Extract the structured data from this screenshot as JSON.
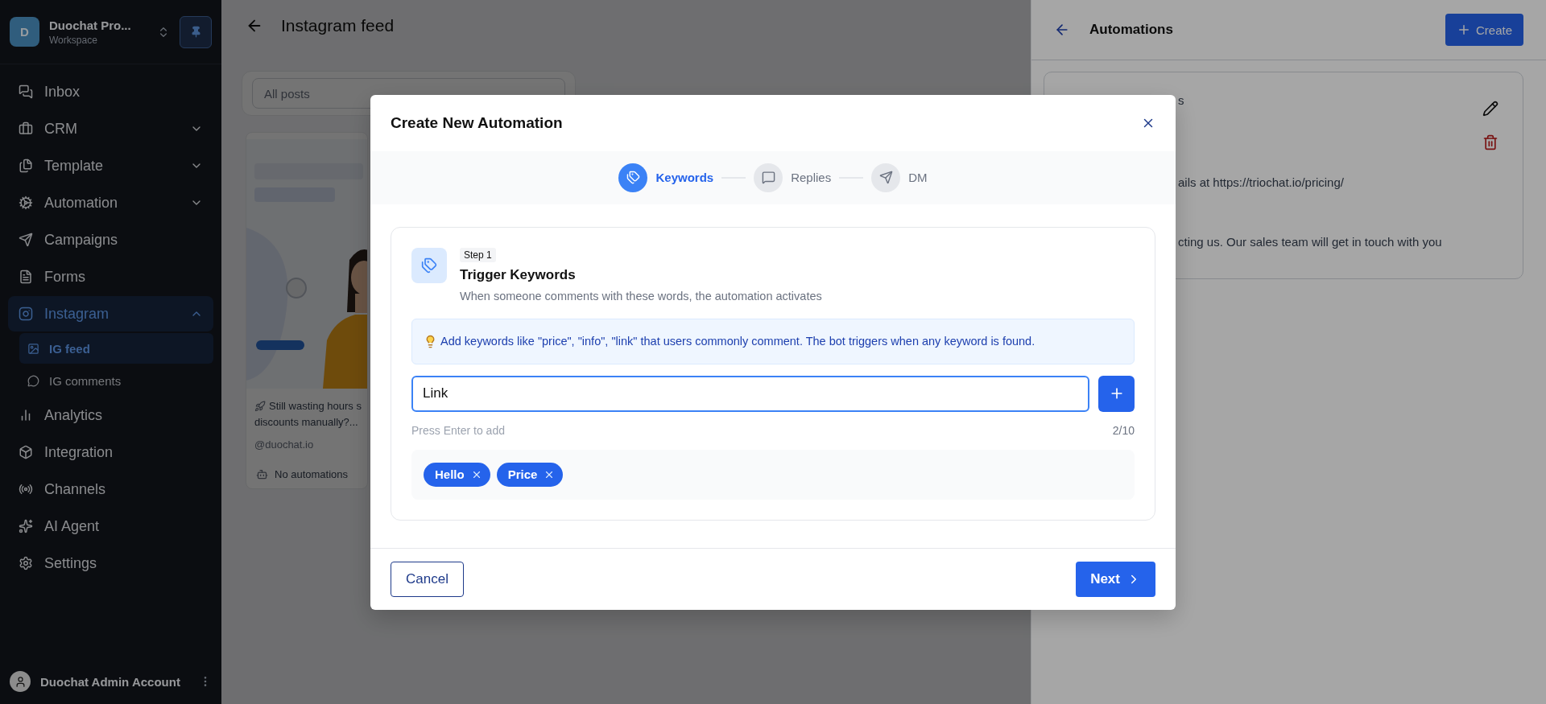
{
  "sidebar": {
    "workspace": {
      "avatar": "D",
      "name": "Duochat Pro...",
      "subtitle": "Workspace"
    },
    "items": [
      {
        "label": "Inbox",
        "selected": false
      },
      {
        "label": "CRM",
        "selected": false,
        "expanded": false
      },
      {
        "label": "Template",
        "selected": false,
        "expanded": false
      },
      {
        "label": "Automation",
        "selected": false,
        "expanded": false
      },
      {
        "label": "Campaigns",
        "selected": false
      },
      {
        "label": "Forms",
        "selected": false
      },
      {
        "label": "Instagram",
        "selected": true,
        "expanded": true,
        "children": [
          {
            "label": "IG feed",
            "selected": true
          },
          {
            "label": "IG comments",
            "selected": false
          }
        ]
      },
      {
        "label": "Analytics",
        "selected": false
      },
      {
        "label": "Integration",
        "selected": false
      },
      {
        "label": "Channels",
        "selected": false
      },
      {
        "label": "AI Agent",
        "selected": false
      },
      {
        "label": "Settings",
        "selected": false
      }
    ],
    "account": {
      "name": "Duochat Admin Account"
    }
  },
  "main": {
    "title": "Instagram feed",
    "filter": {
      "value": "All posts"
    },
    "posts": [
      {
        "kind": "picture",
        "caption_lines": [
          "Still wasting hours s",
          "discounts manually?..."
        ],
        "handle": "@duochat.io",
        "status": "No automations"
      }
    ]
  },
  "drawer": {
    "title": "Automations",
    "create_button": "Create",
    "card": {
      "lines": [
        "s",
        "ails at https://triochat.io/pricing/",
        "cting us. Our sales team will get in touch with you"
      ]
    }
  },
  "modal": {
    "title": "Create New Automation",
    "steps": [
      {
        "label": "Keywords",
        "selected": true
      },
      {
        "label": "Replies",
        "selected": false
      },
      {
        "label": "DM",
        "selected": false
      }
    ],
    "section": {
      "badge": "Step 1",
      "title": "Trigger Keywords",
      "description": "When someone comments with these words, the automation activates"
    },
    "tip": "Add keywords like \"price\", \"info\", \"link\" that users commonly comment. The bot triggers when any keyword is found.",
    "input": {
      "value": "Link"
    },
    "hint": "Press Enter to add",
    "counter": "2/10",
    "keywords": [
      "Hello",
      "Price"
    ],
    "buttons": {
      "cancel": "Cancel",
      "next": "Next"
    }
  }
}
